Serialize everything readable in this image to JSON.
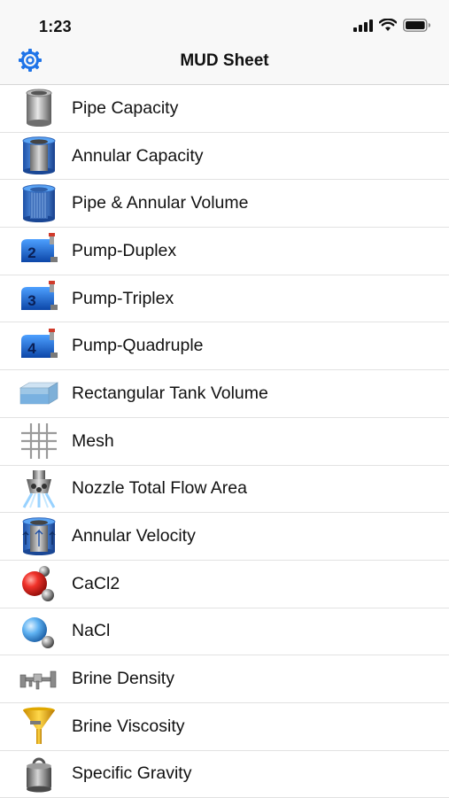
{
  "status": {
    "time": "1:23"
  },
  "nav": {
    "title": "MUD Sheet"
  },
  "items": [
    {
      "label": "Pipe Capacity",
      "icon": "pipe-cylinder-icon"
    },
    {
      "label": "Annular Capacity",
      "icon": "annular-cylinder-icon"
    },
    {
      "label": "Pipe & Annular Volume",
      "icon": "pipe-annular-volume-icon"
    },
    {
      "label": "Pump-Duplex",
      "icon": "pump-duplex-icon"
    },
    {
      "label": "Pump-Triplex",
      "icon": "pump-triplex-icon"
    },
    {
      "label": "Pump-Quadruple",
      "icon": "pump-quadruple-icon"
    },
    {
      "label": "Rectangular Tank Volume",
      "icon": "rectangular-tank-icon"
    },
    {
      "label": "Mesh",
      "icon": "mesh-grid-icon"
    },
    {
      "label": "Nozzle Total Flow Area",
      "icon": "nozzle-icon"
    },
    {
      "label": "Annular Velocity",
      "icon": "annular-velocity-icon"
    },
    {
      "label": "CaCl2",
      "icon": "cacl2-molecule-icon"
    },
    {
      "label": "NaCl",
      "icon": "nacl-molecule-icon"
    },
    {
      "label": "Brine Density",
      "icon": "brine-density-icon"
    },
    {
      "label": "Brine Viscosity",
      "icon": "funnel-icon"
    },
    {
      "label": "Specific Gravity",
      "icon": "weight-icon"
    }
  ],
  "colors": {
    "accent": "#1f74e8"
  }
}
